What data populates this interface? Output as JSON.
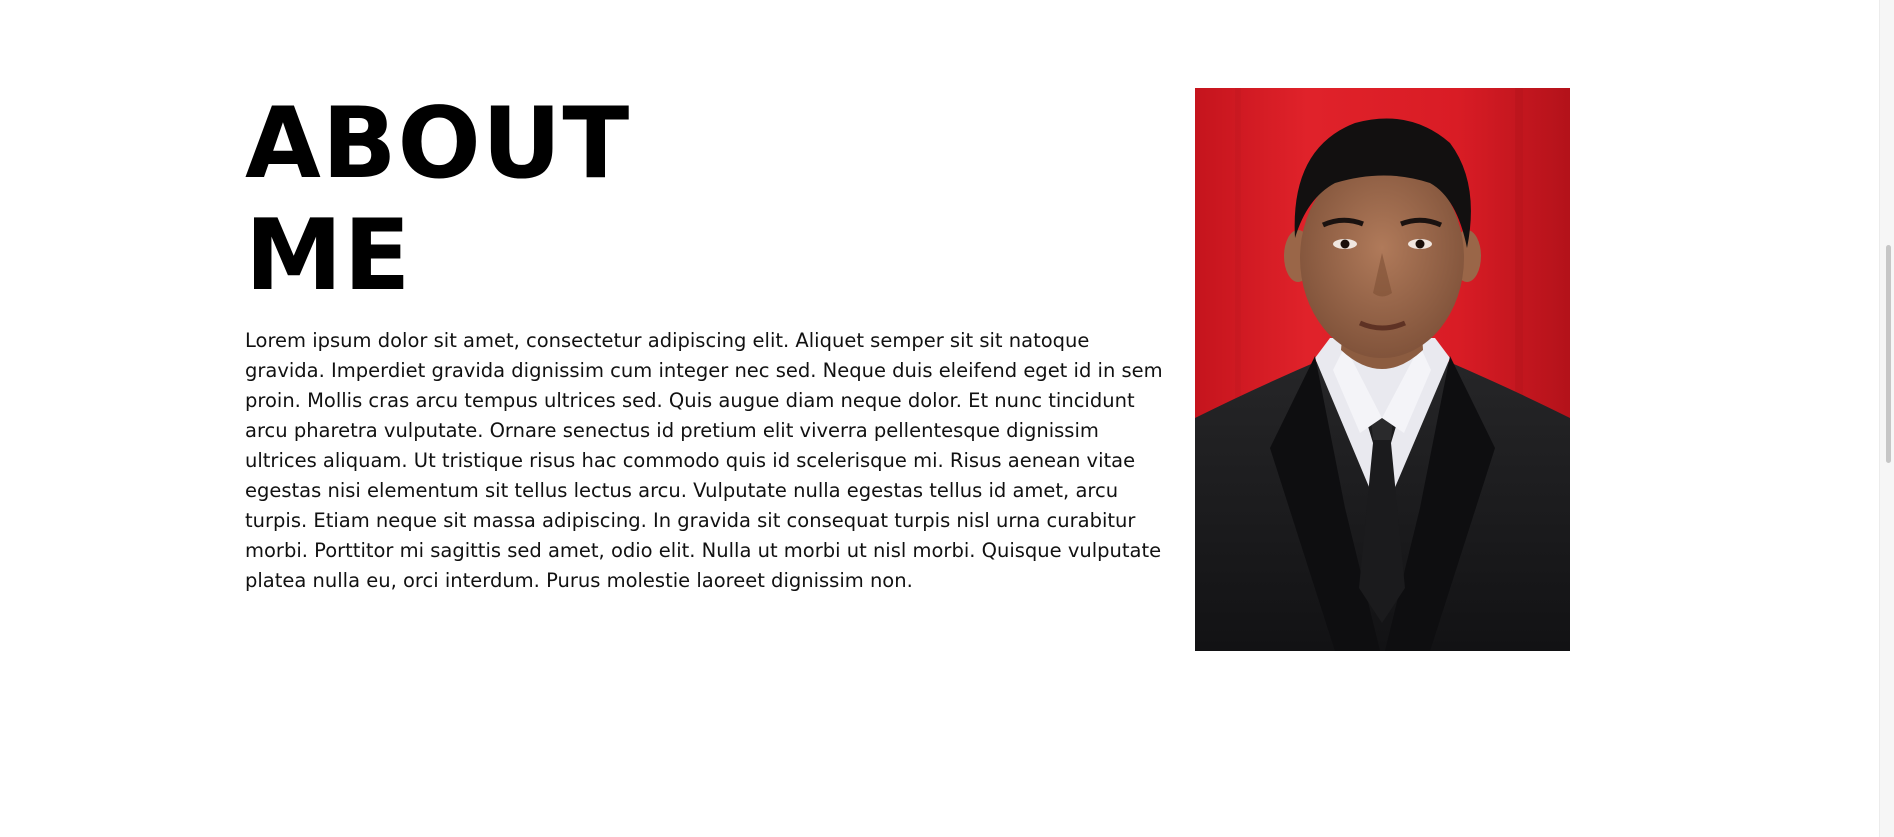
{
  "about": {
    "heading_line1": "ABOUT",
    "heading_line2": "ME",
    "paragraph": "Lorem ipsum dolor sit amet, consectetur adipiscing elit. Aliquet semper sit sit natoque gravida. Imperdiet gravida dignissim cum integer nec sed. Neque duis eleifend eget id in sem proin. Mollis cras arcu tempus ultrices sed. Quis augue diam neque dolor. Et nunc tincidunt arcu pharetra vulputate. Ornare senectus id pretium elit viverra pellentesque dignissim ultrices aliquam. Ut tristique risus hac commodo quis id scelerisque mi. Risus aenean vitae egestas nisi elementum sit tellus lectus arcu. Vulputate nulla egestas tellus id amet, arcu turpis. Etiam neque sit massa adipiscing. In gravida sit consequat turpis nisl urna curabitur morbi. Porttitor mi sagittis sed amet, odio elit. Nulla ut morbi ut nisl morbi. Quisque vulputate platea nulla eu, orci interdum. Purus molestie laoreet dignissim non."
  },
  "colors": {
    "background": "#ffffff",
    "heading_text": "#000000",
    "body_text": "#111111",
    "photo_backdrop": "#d81c24",
    "suit": "#1a1a1c"
  }
}
